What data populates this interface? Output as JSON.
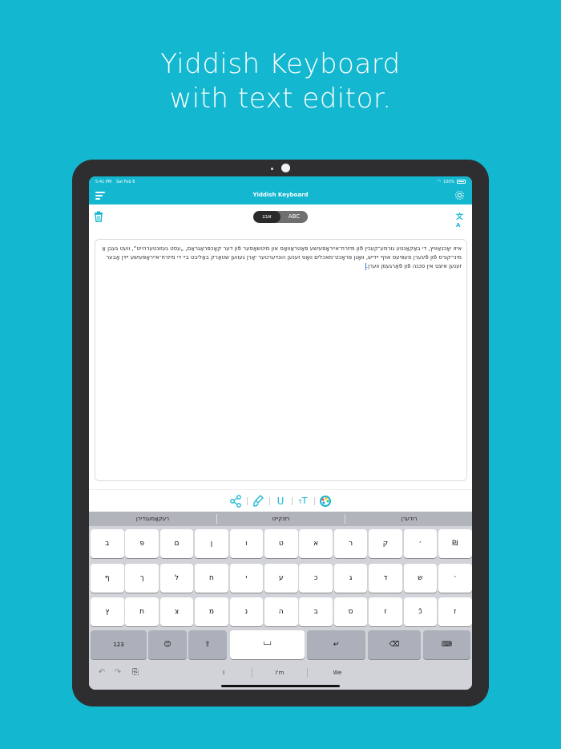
{
  "headline": {
    "line1": "Yiddish Keyboard",
    "line2": "with text editor."
  },
  "status_bar": {
    "time": "5:41 PM",
    "date": "Sat Feb 6",
    "battery": "100%"
  },
  "nav": {
    "title": "Yiddish Keyboard"
  },
  "toolbar": {
    "segments": [
      "אבג",
      "ABC"
    ],
    "selected_segment": "אבג",
    "translate_icon": "translate-icon",
    "trash_icon": "trash-icon"
  },
  "editor": {
    "text": "איזו יאָכנאַוויץ, די באַקאַנטע גורמע־קעכין פֿון מיזרח־אייראָפּעיִשע פּאַטראַוואָס און מיטשאָפער פֿון דער קאָכפּראַגראַם, „עסט געזונטערהייט“, וועט געבן אַ מיני־קורס פֿון פֿיגערן סעפּיעס אויף יידיש, וואָגן פּראָכט־מאכלים וואָס זענען הונדערטער יאָרן געווען שטאַרק באַליבט ביי די מיזרח־אייראָפּעיִשע יידן אָבער זענען איצט אין סכנה פֿון פֿאַרגעסן ווערן."
  },
  "format_bar": {
    "icons": [
      "share-icon",
      "brush-icon",
      "underline-icon",
      "text-size-icon",
      "color-picker-icon"
    ],
    "underline_glyph": "U",
    "textsize_glyph": "T"
  },
  "keyboard": {
    "suggestions": [
      "רעקאָמענדירן",
      "רײַנקייט",
      "רודערן"
    ],
    "row1": [
      "ב",
      "פּ",
      "ם",
      "ן",
      "ו",
      "ט",
      "א",
      "ר",
      "ק",
      "׳",
      "₪"
    ],
    "row2": [
      "ף",
      "ך",
      "ל",
      "ח",
      "י",
      "ע",
      "כ",
      "ג",
      "ד",
      "ש",
      "׳"
    ],
    "row3": [
      "ץ",
      "ת",
      "צ",
      "מ",
      "נ",
      "ה",
      "ב",
      "ס",
      "ז",
      "כֿ",
      "ז"
    ],
    "numbers_key": "123",
    "emoji_icon": "😊",
    "shift_icon": "⇧",
    "space_icon": "└─┘",
    "return_icon": "↵",
    "delete_icon": "⌫",
    "hide_icon": "⌨"
  },
  "bottom_bar": {
    "words": [
      "I",
      "I'm",
      "We"
    ],
    "undo_icon": "↶",
    "redo_icon": "↷",
    "paste_icon": "⎘"
  },
  "colors": {
    "accent": "#13b7d0",
    "device": "#2e2e30",
    "keyboard_bg": "#d1d3d9",
    "key_dark": "#abb0ba"
  }
}
